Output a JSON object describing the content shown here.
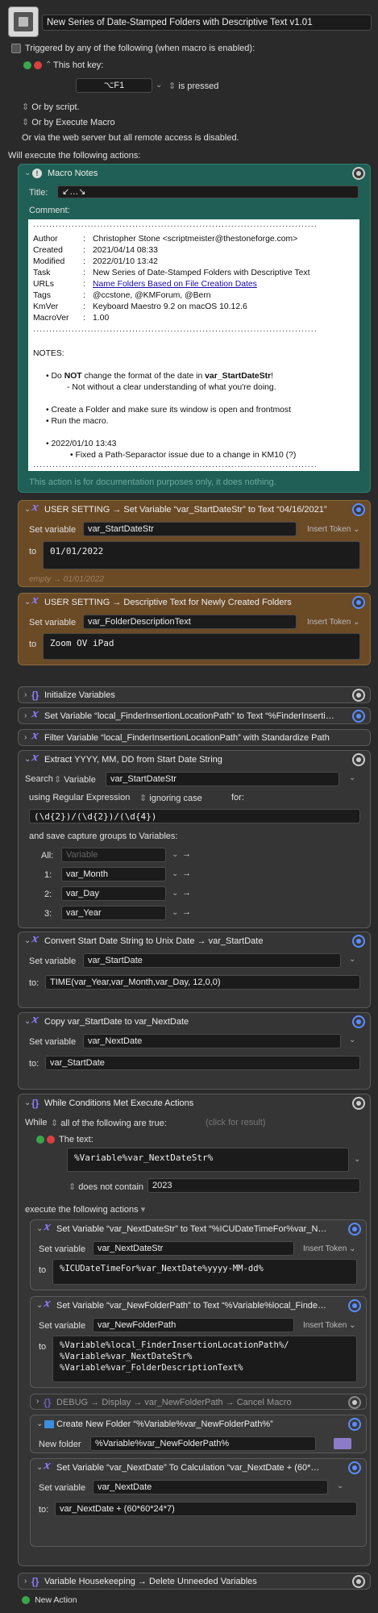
{
  "macro": {
    "name": "New Series of Date-Stamped Folders with Descriptive Text v1.01"
  },
  "triggers": {
    "any_label": "Triggered by any of the following (when macro is enabled):",
    "hotkey_label": "This hot key:",
    "hotkey_value": "⌥F1",
    "pressed": "is pressed",
    "by_script": "Or by script.",
    "by_execute": "Or by Execute Macro",
    "web": "Or via the web server but all remote access is disabled.",
    "will_execute": "Will execute the following actions:"
  },
  "notes": {
    "title": "Macro Notes",
    "title_label": "Title:",
    "title_value": "↙…↘",
    "comment_label": "Comment:",
    "rule": "·························································································",
    "lines": [
      [
        "Author",
        "Christopher Stone <scriptmeister@thestoneforge.com>"
      ],
      [
        "Created",
        "2021/04/14 08:33"
      ],
      [
        "Modified",
        "2022/01/10 13:42"
      ],
      [
        "Task",
        "New Series of Date-Stamped Folders with Descriptive Text"
      ],
      [
        "URLs",
        "Name Folders Based on File Creation Dates"
      ],
      [
        "Tags",
        "@ccstone, @KMForum, @Bern"
      ],
      [
        "KmVer",
        "Keyboard Maestro 9.2 on macOS 10.12.6"
      ],
      [
        "MacroVer",
        "1.00"
      ]
    ],
    "notes_head": "NOTES:",
    "b1a": "Do ",
    "b1b": "NOT",
    "b1c": " change the format of the date in ",
    "b1d": "var_StartDateStr",
    "b1e": "!",
    "b1sub": "- Not without a clear understanding of what you're doing.",
    "b2": "Create a Folder and make sure its window is open and frontmost",
    "b3": "Run the macro.",
    "b4": "2022/01/10 13:43",
    "b4sub": "Fixed a Path-Separactor issue due to a change in KM10 (?)",
    "footer": "This action is for documentation purposes only, it does nothing."
  },
  "a1": {
    "title": "USER SETTING → Set Variable “var_StartDateStr” to Text “04/16/2021”",
    "set": "Set variable",
    "var": "var_StartDateStr",
    "insert": "Insert Token",
    "to": "to",
    "value": "01/01/2022",
    "empty": "empty → 01/01/2022"
  },
  "a2": {
    "title": "USER SETTING → Descriptive Text for Newly Created Folders",
    "set": "Set variable",
    "var": "var_FolderDescriptionText",
    "insert": "Insert Token",
    "to": "to",
    "value": "Zoom OV iPad"
  },
  "c1": {
    "title": "Initialize Variables"
  },
  "c2": {
    "title": "Set Variable “local_FinderInsertionLocationPath” to Text “%FinderInserti…"
  },
  "c3": {
    "title": "Filter Variable “local_FinderInsertionLocationPath” with Standardize Path"
  },
  "a3": {
    "title": "Extract YYYY, MM, DD from Start Date String",
    "search": "Search",
    "variable": "Variable",
    "var": "var_StartDateStr",
    "using": "using Regular Expression",
    "ignoring": "ignoring case",
    "for": "for:",
    "regex": "(\\d{2})/(\\d{2})/(\\d{4})",
    "save": "and save capture groups to Variables:",
    "all": "All:",
    "all_ph": "Variable",
    "n1": "1:",
    "v1": "var_Month",
    "n2": "2:",
    "v2": "var_Day",
    "n3": "3:",
    "v3": "var_Year"
  },
  "a4": {
    "title": "Convert Start Date String to Unix Date → var_StartDate",
    "set": "Set variable",
    "var": "var_StartDate",
    "to": "to:",
    "value": "TIME(var_Year,var_Month,var_Day, 12,0,0)"
  },
  "a5": {
    "title": "Copy var_StartDate to var_NextDate",
    "set": "Set variable",
    "var": "var_NextDate",
    "to": "to:",
    "value": "var_StartDate"
  },
  "w": {
    "title": "While Conditions Met Execute Actions",
    "while": "While",
    "cond": "all of the following are true:",
    "click": "(click for result)",
    "text_label": "The text:",
    "text_value": "%Variable%var_NextDateStr%",
    "not_contain": "does not contain",
    "value": "2023",
    "execute": "execute the following actions"
  },
  "w1": {
    "title": "Set Variable “var_NextDateStr” to Text “%ICUDateTimeFor%var_N…",
    "set": "Set variable",
    "var": "var_NextDateStr",
    "insert": "Insert Token",
    "to": "to",
    "value": "%ICUDateTimeFor%var_NextDate%yyyy-MM-dd%"
  },
  "w2": {
    "title": "Set Variable “var_NewFolderPath” to Text “%Variable%local_Finde…",
    "set": "Set variable",
    "var": "var_NewFolderPath",
    "insert": "Insert Token",
    "to": "to",
    "l1": "%Variable%local_FinderInsertionLocationPath%/",
    "l2": "%Variable%var_NextDateStr%",
    "l3": "%Variable%var_FolderDescriptionText%"
  },
  "w3": {
    "title": "DEBUG → Display → var_NewFolderPath → Cancel Macro"
  },
  "w4": {
    "title": "Create New Folder “%Variable%var_NewFolderPath%”",
    "label": "New folder",
    "value": "%Variable%var_NewFolderPath%"
  },
  "w5": {
    "title": "Set Variable “var_NextDate” To Calculation “var_NextDate + (60*…",
    "set": "Set variable",
    "var": "var_NextDate",
    "to": "to:",
    "value": "var_NextDate + (60*60*24*7)"
  },
  "c4": {
    "title": "Variable Housekeeping → Delete Unneeded Variables"
  },
  "new_action": "New Action",
  "colors": {
    "notes_bg": "#1f5f55",
    "user_bg": "#6b4a26",
    "accent": "#5b8cff",
    "var_icon": "#8c7cff"
  }
}
